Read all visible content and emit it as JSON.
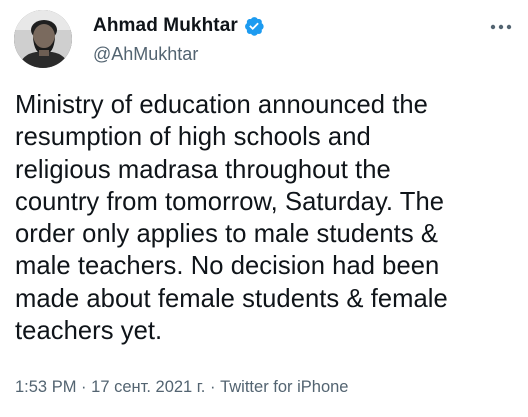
{
  "author": {
    "display_name": "Ahmad Mukhtar",
    "handle": "@AhMukhtar",
    "verified": true,
    "avatar_icon": "user-photo-icon"
  },
  "tweet": {
    "text": "Ministry of education announced the resumption of high schools and religious madrasa throughout the country from tomorrow, Saturday. The order only applies to male students & male teachers. No decision had been made about female students & female teachers yet.",
    "lines": [
      "Ministry of education announced the",
      "resumption of high schools and",
      "religious madrasa throughout the",
      "country from tomorrow, Saturday. The",
      "order only applies to male students &",
      "male teachers. No decision had been",
      "made about female students & female",
      "teachers yet."
    ],
    "time": "1:53 PM",
    "separator": "·",
    "date": "17 сент. 2021 г.",
    "source": "Twitter for iPhone"
  },
  "colors": {
    "text": "#0f1419",
    "secondary": "#536471",
    "verified": "#1d9bf0",
    "background": "#ffffff"
  },
  "icons": {
    "verified": "verified-badge-icon",
    "more": "more-options-icon"
  }
}
